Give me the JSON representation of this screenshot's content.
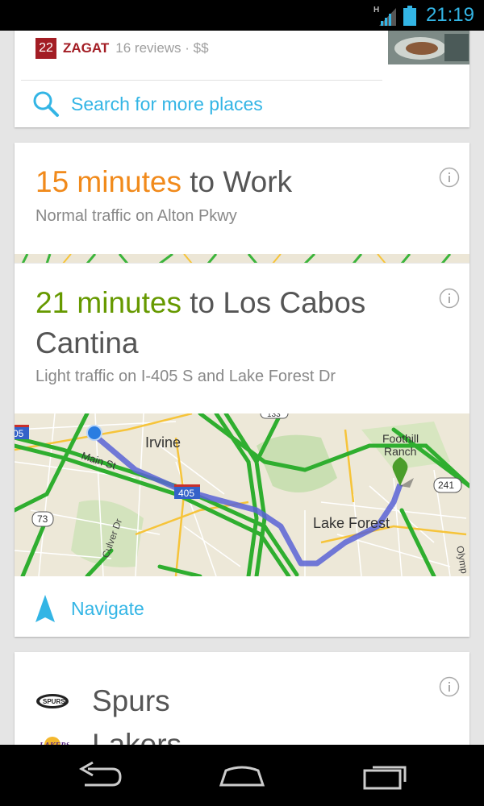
{
  "status_bar": {
    "network_label": "H",
    "time": "21:19",
    "accent_color": "#33b5e5"
  },
  "place_card": {
    "zagat": {
      "score": "22",
      "brand": "ZAGAT",
      "meta": "16 reviews · $$"
    },
    "search_more": "Search for more places"
  },
  "commute_card": {
    "work": {
      "duration": "15 minutes",
      "destination": " to Work",
      "traffic": "Normal traffic on Alton Pkwy"
    },
    "restaurant": {
      "duration": "21 minutes",
      "destination": " to Los Cabos Cantina",
      "traffic": "Light traffic on I-405 S and Lake Forest Dr"
    },
    "map": {
      "labels": {
        "irvine": "Irvine",
        "main_st": "Main St",
        "lake_forest": "Lake Forest",
        "foothill_1": "Foothill",
        "foothill_2": "Ranch",
        "culver": "Culver Dr",
        "olympus": "Olymp",
        "hwy_133": "133",
        "hwy_73": "73",
        "hwy_241": "241",
        "hwy_405": "405",
        "hwy_5": "05"
      }
    },
    "navigate": "Navigate"
  },
  "sports_card": {
    "teams": [
      {
        "name": "Spurs",
        "logo": "spurs-logo"
      },
      {
        "name": "Lakers",
        "logo": "lakers-logo"
      }
    ]
  },
  "nav_bar": {
    "buttons": [
      "back",
      "home",
      "recent-apps"
    ]
  }
}
